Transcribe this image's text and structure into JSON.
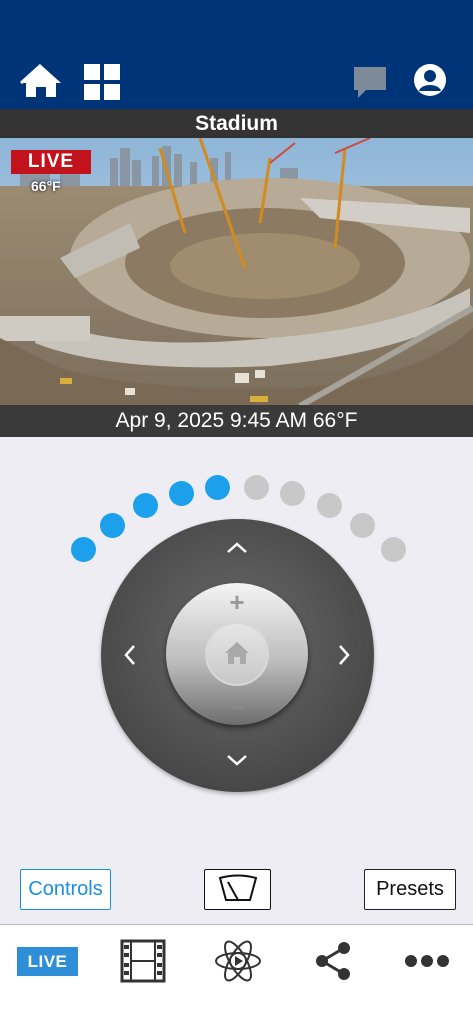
{
  "header": {
    "home_icon": "home-icon",
    "grid_icon": "grid-icon",
    "chat_icon": "chat-icon",
    "profile_icon": "profile-icon"
  },
  "camera": {
    "title": "Stadium",
    "live_badge": "LIVE",
    "temperature": "66°F",
    "caption": "Apr 9, 2025  9:45 AM 66°F"
  },
  "zoom_indicator": {
    "total_steps": 10,
    "active_steps": 5,
    "active_color": "#1ca0ec",
    "inactive_color": "#c8c8c8"
  },
  "joystick": {
    "up_icon": "chevron-up-icon",
    "down_icon": "chevron-down-icon",
    "left_icon": "chevron-left-icon",
    "right_icon": "chevron-right-icon",
    "zoom_in": "+",
    "zoom_out": "−",
    "home_icon": "home-icon"
  },
  "buttons": {
    "controls": "Controls",
    "wiper_icon": "wiper-icon",
    "presets": "Presets"
  },
  "tabbar": {
    "live": "LIVE",
    "film_icon": "film-icon",
    "atom_icon": "atom-play-icon",
    "share_icon": "share-icon",
    "more_icon": "more-icon"
  },
  "colors": {
    "header_bg": "#003478",
    "live_red": "#c2121b",
    "accent_blue": "#1a8fe0"
  }
}
